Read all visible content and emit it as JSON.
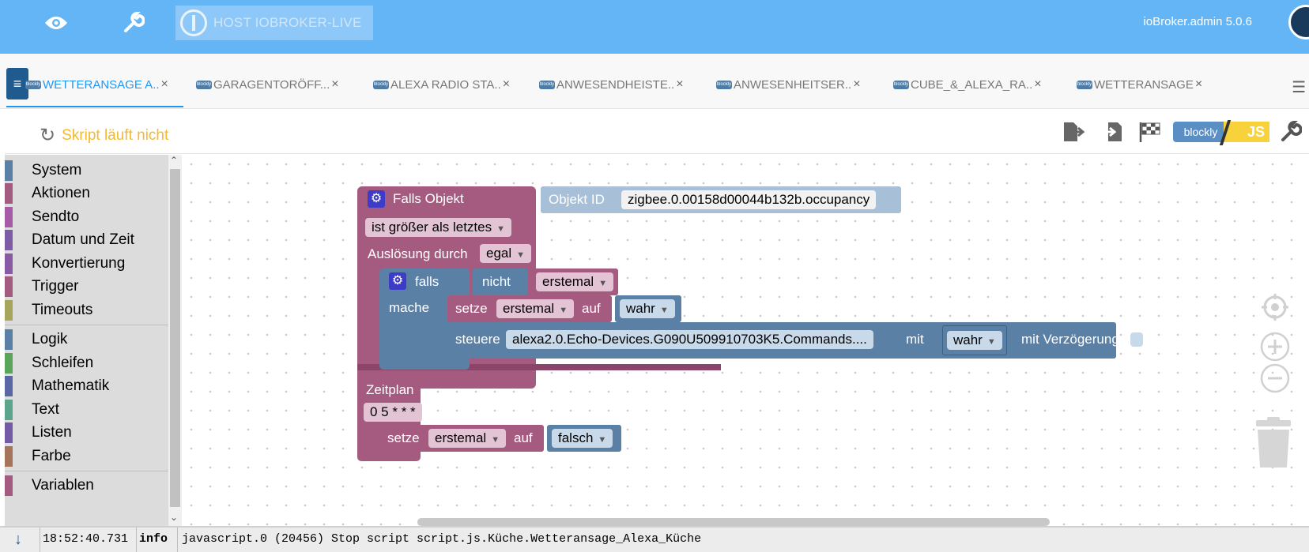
{
  "header": {
    "host_label": "HOST IOBROKER-LIVE",
    "admin_version": "ioBroker.admin 5.0.6"
  },
  "tabs": [
    {
      "label": "WETTERANSAGE A..",
      "active": true
    },
    {
      "label": "GARAGENTORÖFF...",
      "active": false
    },
    {
      "label": "ALEXA RADIO STA..",
      "active": false
    },
    {
      "label": "ANWESENDHEISTE..",
      "active": false
    },
    {
      "label": "ANWESENHEITSER..",
      "active": false
    },
    {
      "label": "CUBE_&_ALEXA_RA..",
      "active": false
    },
    {
      "label": "WETTERANSAGE",
      "active": false
    }
  ],
  "tab_close_glyph": "×",
  "tab_badge_text": "blockly",
  "toolbar": {
    "status": "Skript läuft nicht",
    "mode_blockly": "blockly",
    "mode_js": "JS"
  },
  "sidebar": {
    "categories": [
      {
        "label": "System",
        "color": "#5b80a5"
      },
      {
        "label": "Aktionen",
        "color": "#a55b80"
      },
      {
        "label": "Sendto",
        "color": "#a55ba5"
      },
      {
        "label": "Datum und Zeit",
        "color": "#7e5ba5"
      },
      {
        "label": "Konvertierung",
        "color": "#8a5ba5"
      },
      {
        "label": "Trigger",
        "color": "#a55b80"
      },
      {
        "label": "Timeouts",
        "color": "#a5a55b"
      },
      {
        "label": "Logik",
        "color": "#5b80a5"
      },
      {
        "label": "Schleifen",
        "color": "#5ba55b"
      },
      {
        "label": "Mathematik",
        "color": "#5b67a5"
      },
      {
        "label": "Text",
        "color": "#5ba58c"
      },
      {
        "label": "Listen",
        "color": "#745ba5"
      },
      {
        "label": "Farbe",
        "color": "#a5745b"
      },
      {
        "label": "Variablen",
        "color": "#a55b80"
      }
    ]
  },
  "blocks": {
    "trigger": {
      "title": "Falls Objekt",
      "object_label": "Objekt ID",
      "object_id": "zigbee.0.00158d00044b132b.occupancy",
      "condition": "ist größer als letztes",
      "trigger_label": "Auslösung durch",
      "trigger_value": "egal"
    },
    "if_block": {
      "if_label": "falls",
      "not_label": "nicht",
      "var_name": "erstemal",
      "do_label": "mache"
    },
    "set_block": {
      "set_label": "setze",
      "var_name": "erstemal",
      "to_label": "auf",
      "value": "wahr"
    },
    "control_block": {
      "label": "steuere",
      "target": "alexa2.0.Echo-Devices.G090U509910703K5.Commands....",
      "with_label": "mit",
      "value": "wahr",
      "delay_label": "mit Verzögerung"
    },
    "schedule": {
      "label": "Zeitplan",
      "cron": "0 5 * * *"
    },
    "set_block2": {
      "set_label": "setze",
      "var_name": "erstemal",
      "to_label": "auf",
      "value": "falsch"
    }
  },
  "log": {
    "time": "18:52:40.731",
    "level": "info",
    "message": "javascript.0 (20456) Stop script script.js.Küche.Wetteransage_Alexa_Küche"
  }
}
